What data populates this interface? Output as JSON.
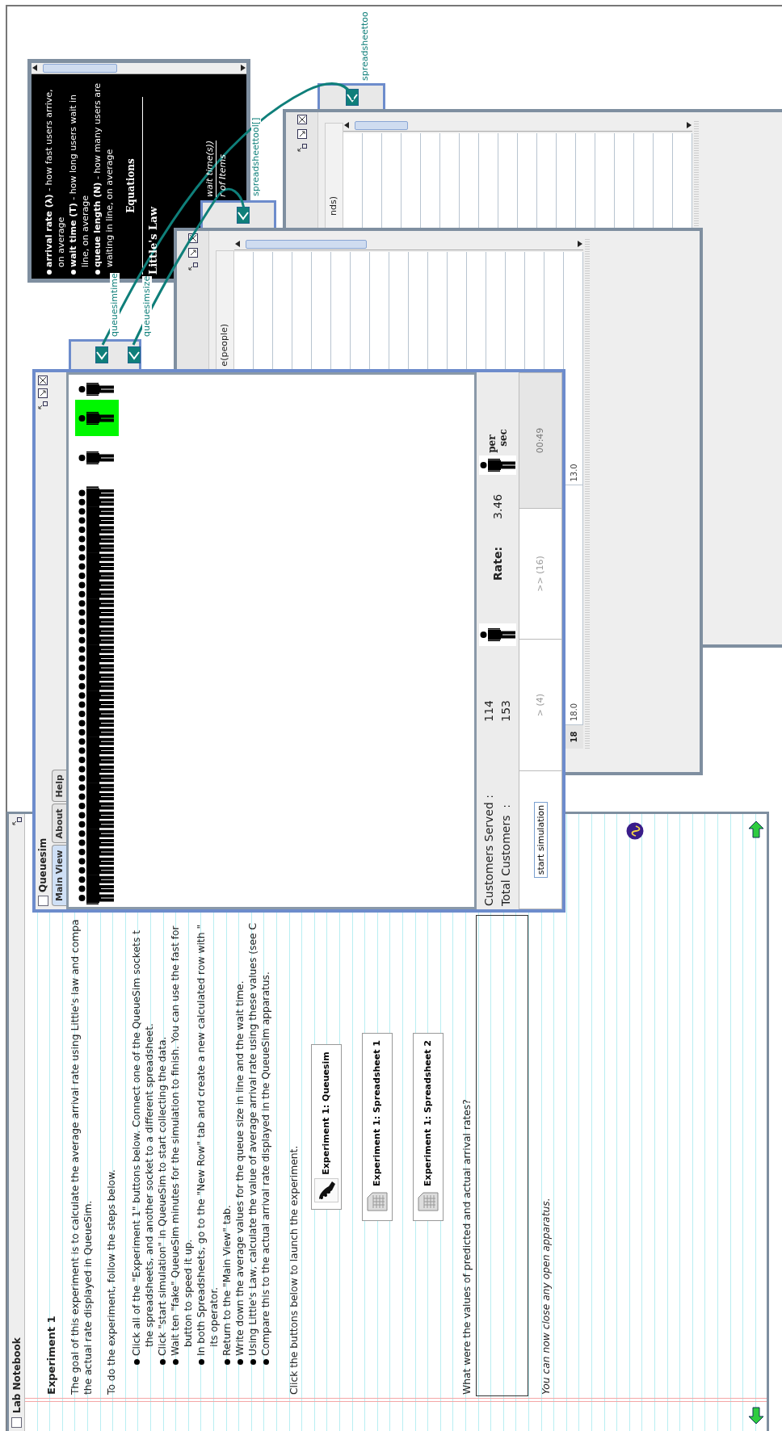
{
  "notebook": {
    "title": "Lab Notebook",
    "heading": "Experiment 1",
    "intro_lines": [
      "The goal of this experiment is to calculate the average arrival rate using Little's law and compa",
      "the actual rate displayed in QueueSim."
    ],
    "steps_intro": "To do the experiment, follow the steps below.",
    "steps": [
      {
        "lines": [
          "Click all of the \"Experiment 1\" buttons below. Connect one of the QueueSim sockets t",
          "the spreadsheets, and another socket to a different spreadsheet."
        ]
      },
      {
        "lines": [
          "Click \"start simulation\" in QueueSim to start collecting the data."
        ]
      },
      {
        "lines": [
          "Wait ten \"fake\" QueueSim minutes for the simulation to finish. You can use the fast for",
          "button to speed it up."
        ]
      },
      {
        "lines": [
          "In both Spreadsheets, go to the \"New Row\" tab and create a new calculated row with \"",
          "its operator."
        ]
      },
      {
        "lines": [
          "Return to the \"Main View\" tab."
        ]
      },
      {
        "lines": [
          "Write down the average values for the queue size in line and the wait time."
        ]
      },
      {
        "lines": [
          "Using Little's Law, calculate the value of average arrival rate using these values (see C"
        ]
      },
      {
        "lines": [
          "Compare this to the actual arrival rate displayed in the QueueSim apparatus."
        ]
      }
    ],
    "launch_text": "Click the buttons below to launch the experiment.",
    "launch_buttons": [
      {
        "label": "Experiment 1: Queuesim",
        "kind": "simulation"
      },
      {
        "label": "Experiment 1: Spreadsheet 1",
        "kind": "spreadsheet"
      },
      {
        "label": "Experiment 1: Spreadsheet 2",
        "kind": "spreadsheet"
      }
    ],
    "question": "What were the values of predicted and actual arrival rates?",
    "closing": "You can now close any open apparatus."
  },
  "queuesim": {
    "title": "Queuesim",
    "tabs": [
      {
        "label": "Main View",
        "selected": true
      },
      {
        "label": "About",
        "selected": false
      },
      {
        "label": "Help",
        "selected": false
      }
    ],
    "stats": [
      {
        "label": "Customers Served :",
        "value": "114"
      },
      {
        "label": "Total Customers  :",
        "value": "153"
      }
    ],
    "rate_label": "Rate:",
    "rate_value": "3.46",
    "rate_unit": [
      "per",
      "sec"
    ],
    "controls": [
      {
        "label": "start simulation",
        "kind": "button",
        "disabled": false
      },
      {
        "label": "> (4)",
        "kind": "speed",
        "disabled": true
      },
      {
        "label": ">> (16)",
        "kind": "speed",
        "disabled": true
      }
    ],
    "clock": "00:49",
    "sockets": [
      {
        "label": "queuesimtime"
      },
      {
        "label": "queuesimsize"
      }
    ]
  },
  "equations_panel": {
    "definitions": [
      "**arrival rate (λ)** - how fast users arrive, on average",
      "**wait time (T)** - how long users wait in line, on average",
      "**queue length (N)** - how many users are waiting in line, on average"
    ],
    "heading": "Equations",
    "law_title": "Little's Law",
    "numerator_fragment": "wait time(s))",
    "denominator_fragment": "r of Items"
  },
  "spreadsheets": [
    {
      "header_fragment": "e(people)",
      "socket_label": "spreadsheettool[]",
      "rows": [
        {
          "number": "18",
          "cells": [
            "18.0",
            "13.0"
          ]
        }
      ]
    },
    {
      "header_fragment": "nds)",
      "socket_label": "spreadsheettoo"
    }
  ]
}
